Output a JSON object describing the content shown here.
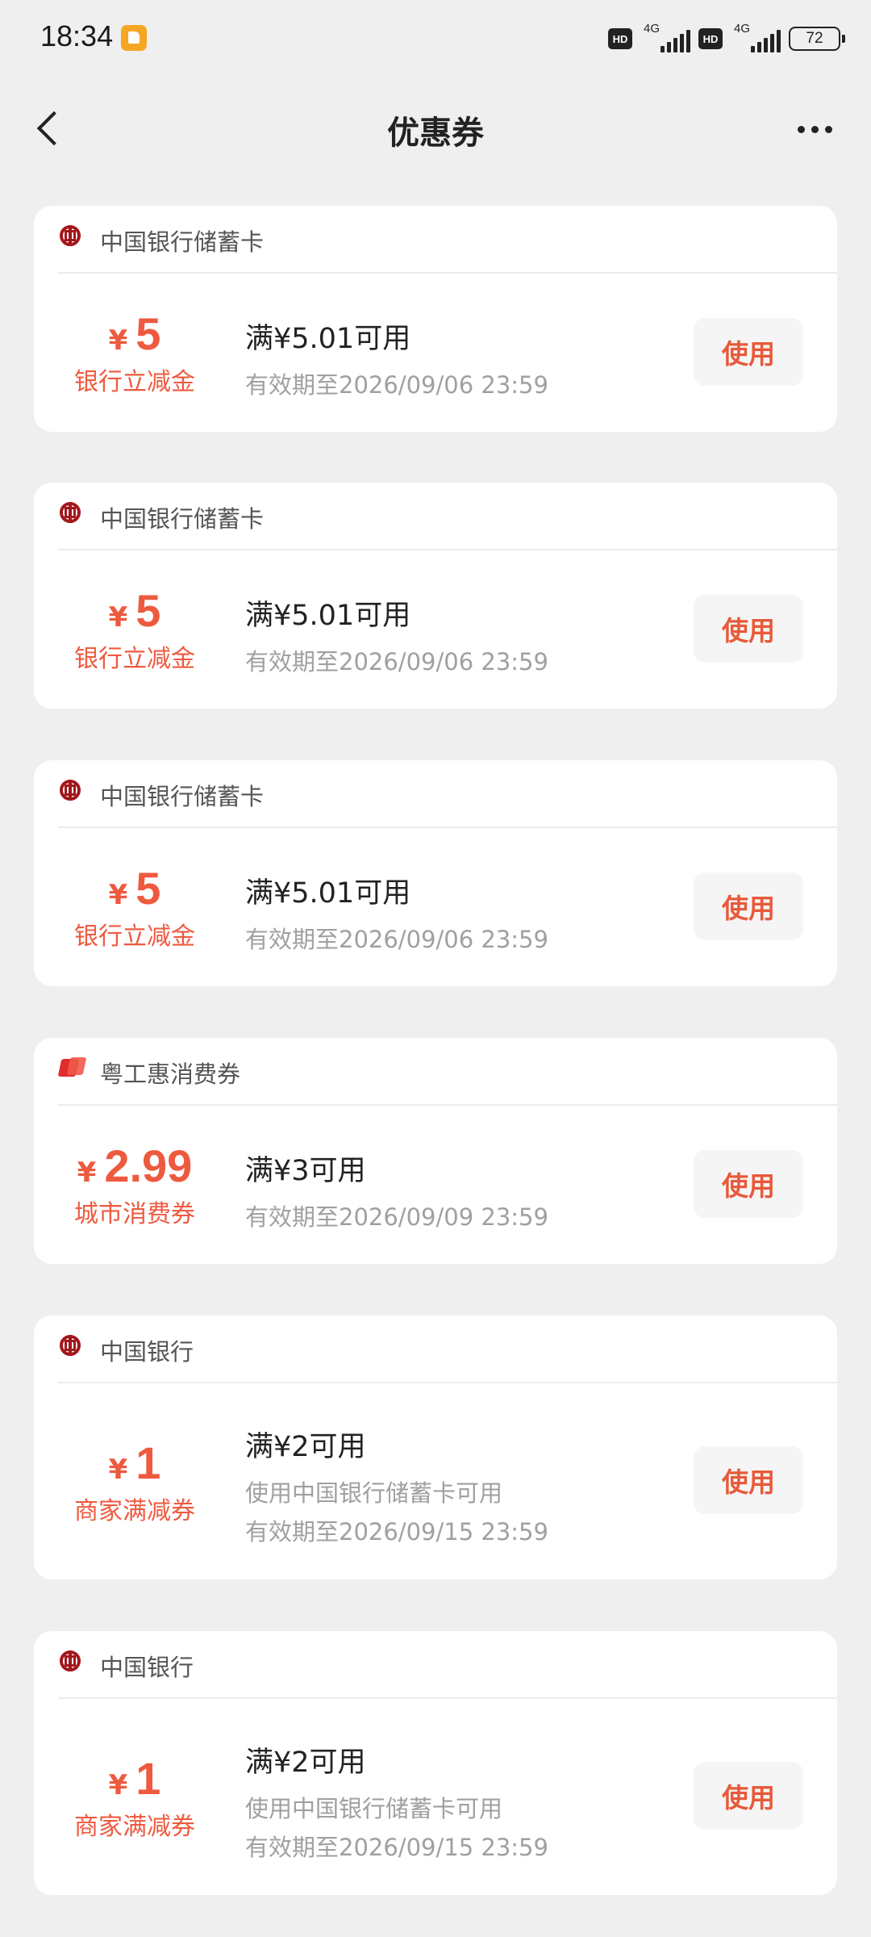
{
  "status_bar": {
    "time": "18:34",
    "hd1": "HD",
    "net1": "4G",
    "hd2": "HD",
    "net2": "4G",
    "battery": "72"
  },
  "nav": {
    "title": "优惠券",
    "back_icon": "chevron-left-icon",
    "more_icon": "more-horizontal-icon"
  },
  "coupons": [
    {
      "issuer": "中国银行储蓄卡",
      "issuer_icon": "boc-logo-icon",
      "currency": "¥",
      "amount": "5",
      "type": "银行立减金",
      "condition": "满¥5.01可用",
      "note": "",
      "validity": "有效期至2026/09/06 23:59",
      "button": "使用"
    },
    {
      "issuer": "中国银行储蓄卡",
      "issuer_icon": "boc-logo-icon",
      "currency": "¥",
      "amount": "5",
      "type": "银行立减金",
      "condition": "满¥5.01可用",
      "note": "",
      "validity": "有效期至2026/09/06 23:59",
      "button": "使用"
    },
    {
      "issuer": "中国银行储蓄卡",
      "issuer_icon": "boc-logo-icon",
      "currency": "¥",
      "amount": "5",
      "type": "银行立减金",
      "condition": "满¥5.01可用",
      "note": "",
      "validity": "有效期至2026/09/06 23:59",
      "button": "使用"
    },
    {
      "issuer": "粤工惠消费券",
      "issuer_icon": "union-logo-icon",
      "currency": "¥",
      "amount": "2.99",
      "type": "城市消费券",
      "condition": "满¥3可用",
      "note": "",
      "validity": "有效期至2026/09/09 23:59",
      "button": "使用"
    },
    {
      "issuer": "中国银行",
      "issuer_icon": "boc-logo-icon",
      "currency": "¥",
      "amount": "1",
      "type": "商家满减券",
      "condition": "满¥2可用",
      "note": "使用中国银行储蓄卡可用",
      "validity": "有效期至2026/09/15 23:59",
      "button": "使用"
    },
    {
      "issuer": "中国银行",
      "issuer_icon": "boc-logo-icon",
      "currency": "¥",
      "amount": "1",
      "type": "商家满减券",
      "condition": "满¥2可用",
      "note": "使用中国银行储蓄卡可用",
      "validity": "有效期至2026/09/15 23:59",
      "button": "使用"
    }
  ]
}
